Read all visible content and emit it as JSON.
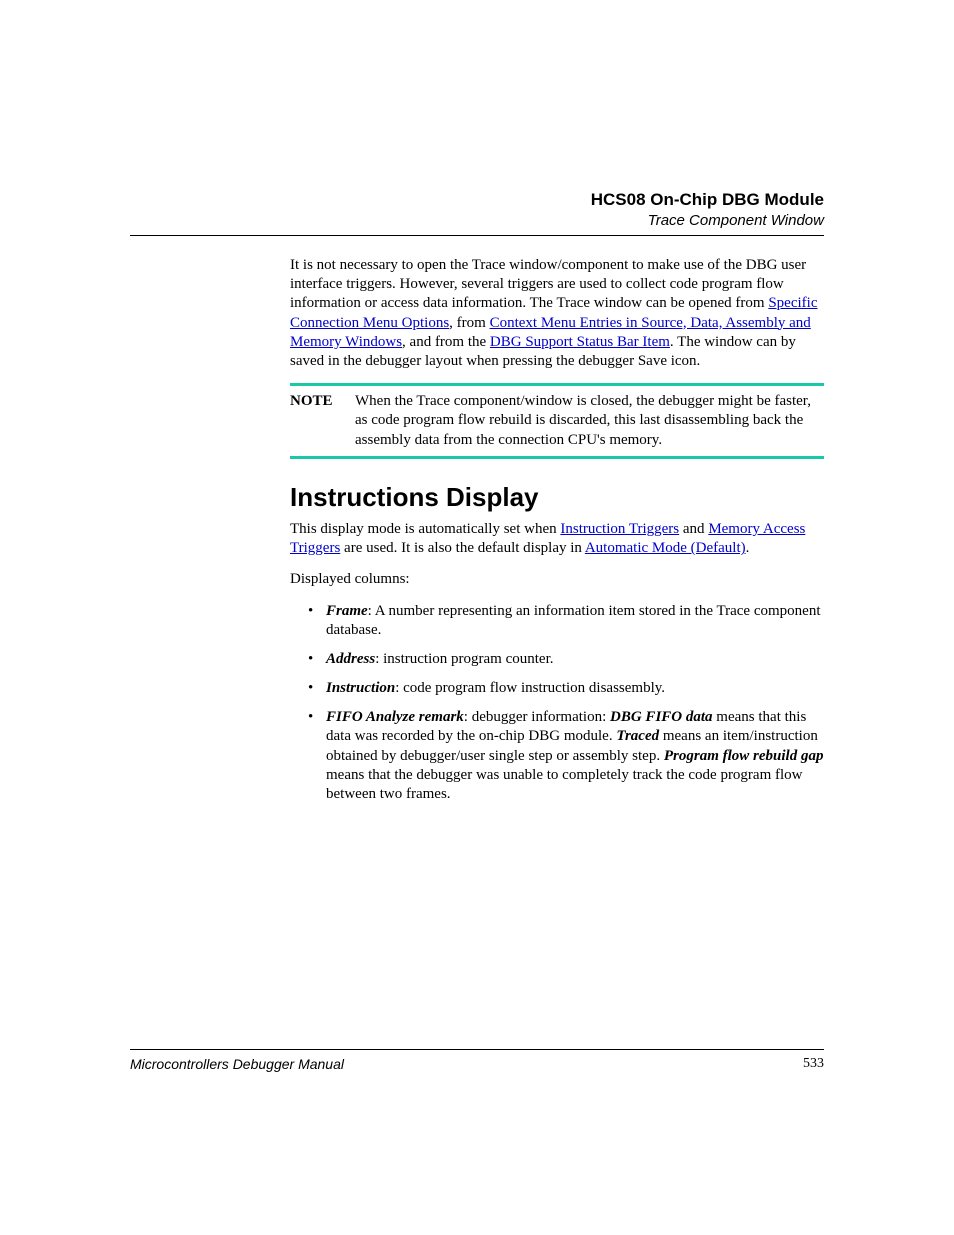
{
  "header": {
    "title": "HCS08 On-Chip DBG Module",
    "subtitle": "Trace Component Window"
  },
  "intro": {
    "t1": "It is not necessary to open the Trace window/component to make use of the DBG user interface triggers. However, several triggers are used to collect code program flow information or access data information. The Trace window can be opened from ",
    "l1": "Specific Connection Menu Options",
    "t2": ", from ",
    "l2": "Context Menu Entries in Source, Data, Assembly and Memory Windows",
    "t3": ", and from the ",
    "l3": "DBG Support Status Bar Item",
    "t4": ". The window can by saved in the debugger layout when pressing the debugger Save icon."
  },
  "note": {
    "label": "NOTE",
    "text": "When the Trace component/window is closed, the debugger might be faster, as code program flow rebuild is discarded, this last disassembling back the assembly data from the connection CPU's memory."
  },
  "section": {
    "heading": "Instructions Display",
    "p1a": "This display mode is automatically set when ",
    "l1": "Instruction Triggers",
    "p1b": " and ",
    "l2": "Memory Access Triggers",
    "p1c": " are used. It is also the default display in ",
    "l3": "Automatic Mode (Default)",
    "p1d": ".",
    "p2": "Displayed columns:",
    "bullets": [
      {
        "term": "Frame",
        "rest": ": A number representing an information item stored in the Trace component database."
      },
      {
        "term": "Address",
        "rest": ": instruction program counter."
      },
      {
        "term": "Instruction",
        "rest": ": code program flow instruction disassembly."
      }
    ],
    "b4": {
      "term1": "FIFO Analyze remark",
      "t1": ": debugger information: ",
      "term2": "DBG FIFO data",
      "t2": " means that this data was recorded by the on-chip DBG module. ",
      "term3": "Traced",
      "t3": " means an item/instruction obtained by debugger/user single step or assembly step. ",
      "term4": "Program flow rebuild gap",
      "t4": " means that the debugger was unable to completely track the code program flow between two frames."
    }
  },
  "footer": {
    "left": "Microcontrollers Debugger Manual",
    "page": "533"
  }
}
